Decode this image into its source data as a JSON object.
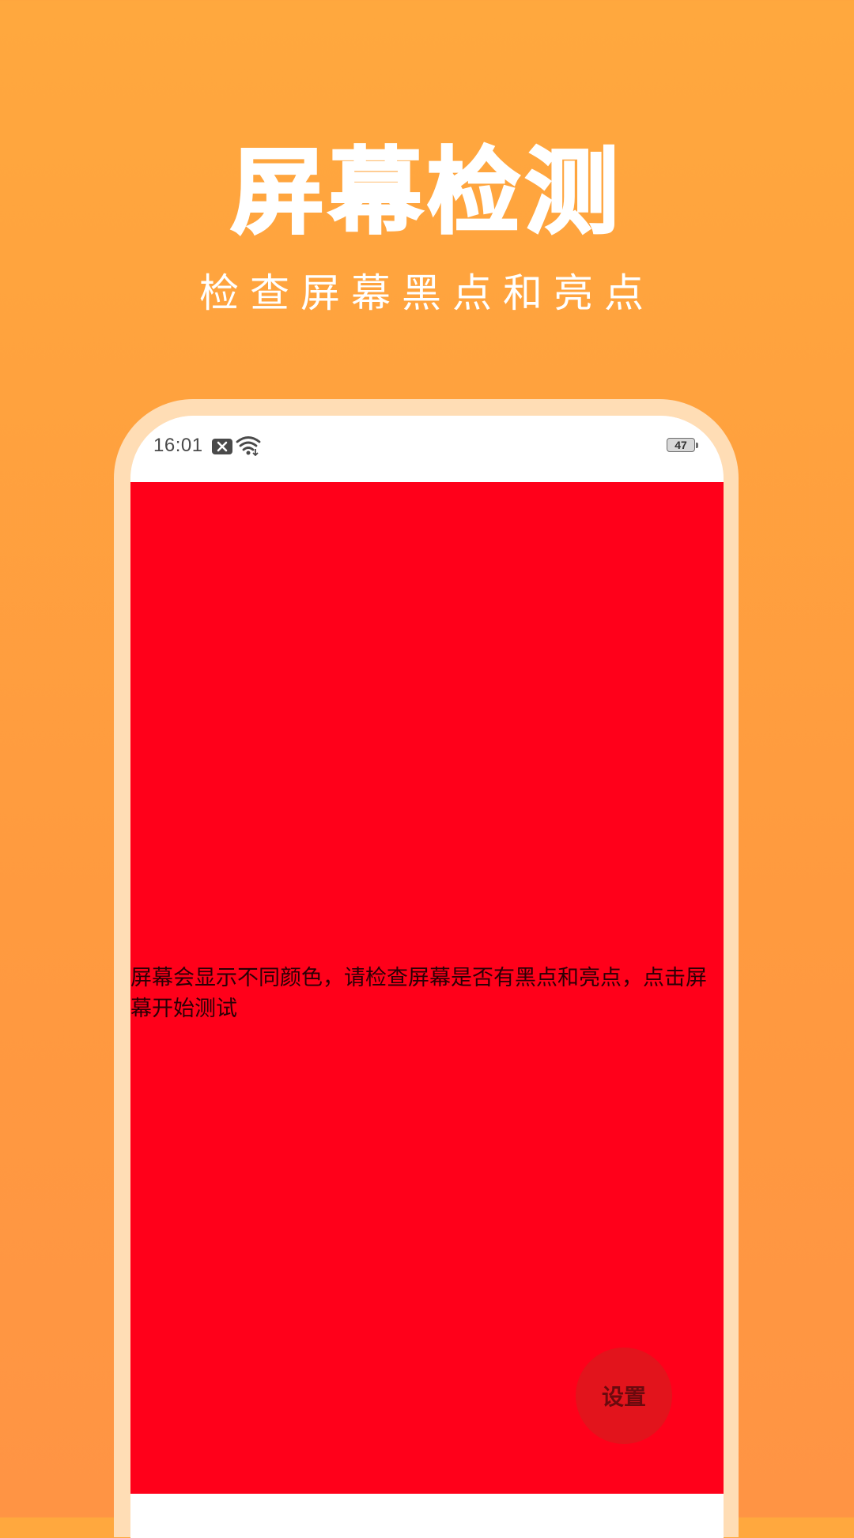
{
  "hero": {
    "title": "屏幕检测",
    "subtitle": "检查屏幕黑点和亮点"
  },
  "status_bar": {
    "time": "16:01",
    "notification_icon": "close-box-icon",
    "wifi_icon": "wifi-icon",
    "battery_level": "47"
  },
  "test_screen": {
    "color": "#FF001A",
    "instruction": "屏幕会显示不同颜色，请检查屏幕是否有黑点和亮点，点击屏幕开始测试",
    "settings_button_label": "设置"
  },
  "colors": {
    "background_top": "#FFA83E",
    "background_bottom": "#FF9444",
    "frame": "#FFDDB5",
    "test_red": "#FF001A"
  }
}
